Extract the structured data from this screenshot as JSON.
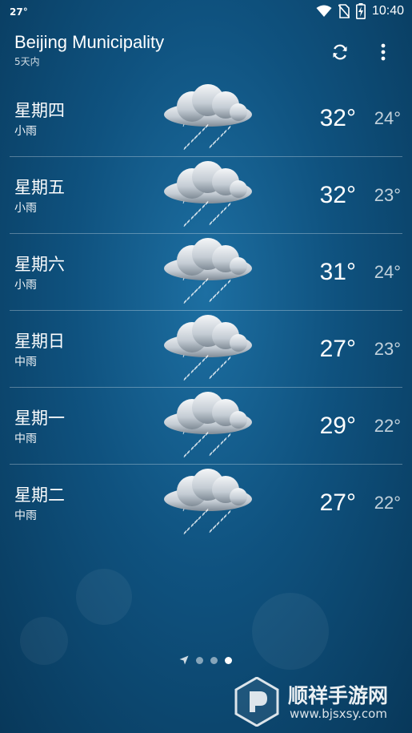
{
  "status_bar": {
    "temp": "27°",
    "time": "10:40"
  },
  "header": {
    "city": "Beijing Municipality",
    "subtitle": "5天内"
  },
  "forecast": [
    {
      "day": "星期四",
      "condition": "小雨",
      "high": "32°",
      "low": "24°"
    },
    {
      "day": "星期五",
      "condition": "小雨",
      "high": "32°",
      "low": "23°"
    },
    {
      "day": "星期六",
      "condition": "小雨",
      "high": "31°",
      "low": "24°"
    },
    {
      "day": "星期日",
      "condition": "中雨",
      "high": "27°",
      "low": "23°"
    },
    {
      "day": "星期一",
      "condition": "中雨",
      "high": "29°",
      "low": "22°"
    },
    {
      "day": "星期二",
      "condition": "中雨",
      "high": "27°",
      "low": "22°"
    }
  ],
  "pager": {
    "pages": 3,
    "active_page": 3
  },
  "watermark": {
    "brand": "顺祥手游网",
    "url": "www.bjsxsy.com"
  },
  "icons": [
    "wifi-icon",
    "no-sim-icon",
    "battery-charging-icon",
    "refresh-icon",
    "more-vert-icon",
    "location-arrow-icon",
    "rain-cloud-icon"
  ],
  "colors": {
    "background": "#0f527f",
    "text": "#ffffff"
  }
}
